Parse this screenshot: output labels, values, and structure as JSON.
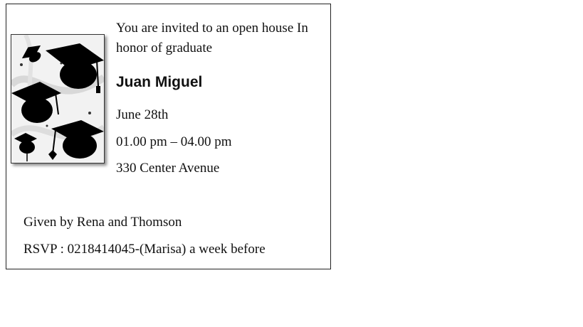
{
  "invitation": {
    "intro": "You are invited to an open house In honor of graduate",
    "graduate_name": "Juan Miguel",
    "date": "June 28th",
    "time": "01.00 pm – 04.00 pm",
    "address": "330 Center Avenue",
    "given_by": "Given by Rena and Thomson",
    "rsvp": "RSVP : 0218414045-(Marisa)  a week before"
  },
  "artwork": {
    "icon": "graduation-caps-icon"
  },
  "colors": {
    "text": "#111111",
    "border": "#222222",
    "cap": "#000000"
  }
}
